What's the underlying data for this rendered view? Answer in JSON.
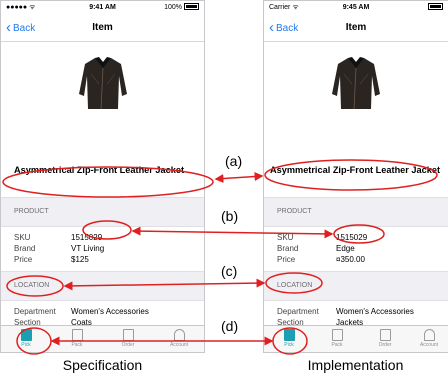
{
  "spec": {
    "status": {
      "carrier": "●●●●● ᯤ",
      "time": "9:41 AM",
      "battery": "100%"
    },
    "nav": {
      "back": "Back",
      "title": "Item"
    },
    "item_title": "Asymmetrical Zip-Front Leather Jacket",
    "product_header": "PRODUCT",
    "product_rows": [
      {
        "key": "SKU",
        "value": "1515029"
      },
      {
        "key": "Brand",
        "value": "VT Living"
      },
      {
        "key": "Price",
        "value": "$125"
      }
    ],
    "location_header": "LOCATION",
    "location_rows": [
      {
        "key": "Department",
        "value": "Women's Accessories"
      },
      {
        "key": "Section",
        "value": "Coats"
      }
    ],
    "tabs": [
      "Pick",
      "Pack",
      "Order",
      "Account"
    ]
  },
  "impl": {
    "status": {
      "carrier": "Carrier ᯤ",
      "time": "9:45 AM"
    },
    "nav": {
      "back": "Back",
      "title": "Item"
    },
    "item_title": "Asymmetrical Zip-Front Leather Jacket",
    "product_header": "PRODUCT",
    "product_rows": [
      {
        "key": "SKU",
        "value": "1515029"
      },
      {
        "key": "Brand",
        "value": "Edge"
      },
      {
        "key": "Price",
        "value": "¤350.00"
      }
    ],
    "location_header": "LOCATION",
    "location_rows": [
      {
        "key": "Department",
        "value": "Women's Accessories"
      },
      {
        "key": "Section",
        "value": "Jackets"
      }
    ],
    "tabs": [
      "Pick",
      "Pack",
      "Order",
      "Account"
    ]
  },
  "annotations": {
    "a": "(a)",
    "b": "(b)",
    "c": "(c)",
    "d": "(d)"
  },
  "captions": {
    "left": "Specification",
    "right": "Implementation"
  },
  "colors": {
    "accent": "#1f7af0",
    "annotation": "#e02020",
    "tab_active": "#1c9fb3"
  }
}
